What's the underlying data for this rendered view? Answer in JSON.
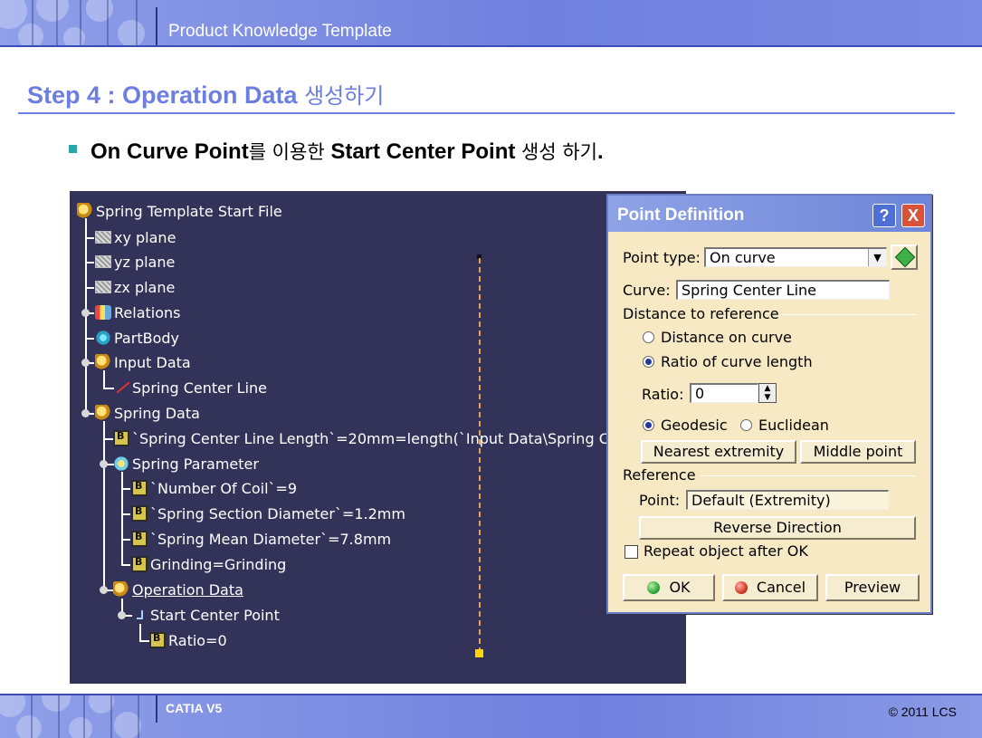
{
  "header": {
    "title": "Product Knowledge Template"
  },
  "slide": {
    "step_title_en": "Step 4 : Operation Data ",
    "step_title_ko": "생성하기",
    "bullet": {
      "part1": "On Curve Point",
      "part2": "를 이용한 ",
      "part3": "Start Center Point",
      "part4": " 생성 하기",
      "part5": "."
    }
  },
  "tree": {
    "root": "Spring Template Start File",
    "xy": "xy plane",
    "yz": "yz plane",
    "zx": "zx plane",
    "relations": "Relations",
    "partbody": "PartBody",
    "input_data": "Input Data",
    "spring_center_line": "Spring Center Line",
    "spring_data": "Spring Data",
    "length_formula": "`Spring Center Line Length`=20mm=length(`Input Data\\Spring Cente",
    "spring_parameter": "Spring Parameter",
    "num_coil": "`Number Of Coil`=9",
    "section_dia": "`Spring Section Diameter`=1.2mm",
    "mean_dia": "`Spring Mean Diameter`=7.8mm",
    "grinding": "Grinding=Grinding",
    "operation_data": "Operation Data",
    "start_center_point": "Start Center Point",
    "ratio": "Ratio=0"
  },
  "dialog": {
    "title": "Point Definition",
    "help": "?",
    "close": "X",
    "point_type_label": "Point type:",
    "point_type_value": "On curve",
    "curve_label": "Curve:",
    "curve_value": "Spring Center Line",
    "distance_section": "Distance to reference",
    "opt_distance": "Distance on curve",
    "opt_ratio": "Ratio of curve length",
    "ratio_label": "Ratio:",
    "ratio_value": "0",
    "opt_geodesic": "Geodesic",
    "opt_euclidean": "Euclidean",
    "nearest_btn": "Nearest extremity",
    "middle_btn": "Middle point",
    "reference_section": "Reference",
    "point_label": "Point:",
    "point_value": "Default (Extremity)",
    "reverse_btn": "Reverse Direction",
    "repeat_chk": "Repeat object after OK",
    "ok_btn": "OK",
    "cancel_btn": "Cancel",
    "preview_btn": "Preview"
  },
  "footer": {
    "left": "CATIA V5",
    "right": "© 2011 LCS"
  }
}
